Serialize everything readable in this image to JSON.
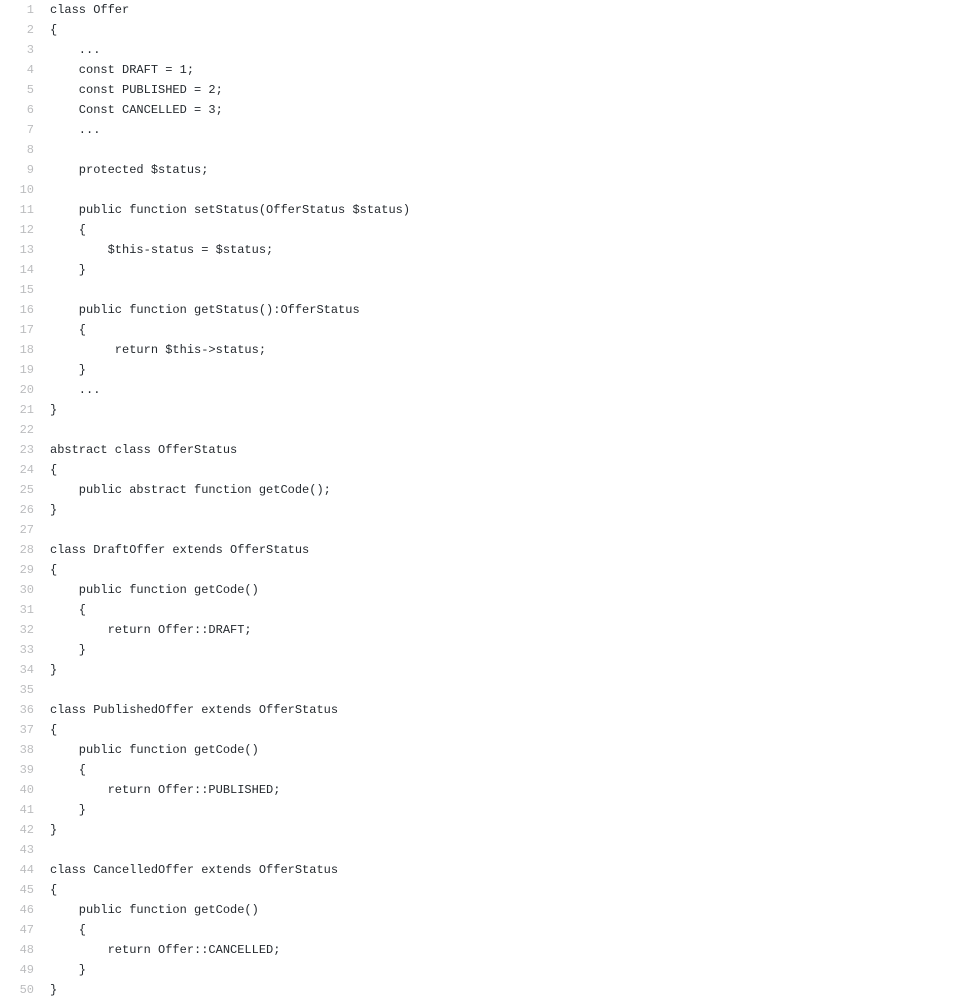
{
  "code": {
    "lines": [
      {
        "num": "1",
        "text": "class Offer"
      },
      {
        "num": "2",
        "text": "{"
      },
      {
        "num": "3",
        "text": "    ..."
      },
      {
        "num": "4",
        "text": "    const DRAFT = 1;"
      },
      {
        "num": "5",
        "text": "    const PUBLISHED = 2;"
      },
      {
        "num": "6",
        "text": "    Const CANCELLED = 3;"
      },
      {
        "num": "7",
        "text": "    ..."
      },
      {
        "num": "8",
        "text": ""
      },
      {
        "num": "9",
        "text": "    protected $status;"
      },
      {
        "num": "10",
        "text": ""
      },
      {
        "num": "11",
        "text": "    public function setStatus(OfferStatus $status)"
      },
      {
        "num": "12",
        "text": "    {"
      },
      {
        "num": "13",
        "text": "        $this-status = $status;"
      },
      {
        "num": "14",
        "text": "    }"
      },
      {
        "num": "15",
        "text": ""
      },
      {
        "num": "16",
        "text": "    public function getStatus():OfferStatus"
      },
      {
        "num": "17",
        "text": "    {"
      },
      {
        "num": "18",
        "text": "         return $this->status;"
      },
      {
        "num": "19",
        "text": "    }"
      },
      {
        "num": "20",
        "text": "    ..."
      },
      {
        "num": "21",
        "text": "}"
      },
      {
        "num": "22",
        "text": ""
      },
      {
        "num": "23",
        "text": "abstract class OfferStatus"
      },
      {
        "num": "24",
        "text": "{"
      },
      {
        "num": "25",
        "text": "    public abstract function getCode();"
      },
      {
        "num": "26",
        "text": "}"
      },
      {
        "num": "27",
        "text": ""
      },
      {
        "num": "28",
        "text": "class DraftOffer extends OfferStatus"
      },
      {
        "num": "29",
        "text": "{"
      },
      {
        "num": "30",
        "text": "    public function getCode()"
      },
      {
        "num": "31",
        "text": "    {"
      },
      {
        "num": "32",
        "text": "        return Offer::DRAFT;"
      },
      {
        "num": "33",
        "text": "    }"
      },
      {
        "num": "34",
        "text": "}"
      },
      {
        "num": "35",
        "text": ""
      },
      {
        "num": "36",
        "text": "class PublishedOffer extends OfferStatus"
      },
      {
        "num": "37",
        "text": "{"
      },
      {
        "num": "38",
        "text": "    public function getCode()"
      },
      {
        "num": "39",
        "text": "    {"
      },
      {
        "num": "40",
        "text": "        return Offer::PUBLISHED;"
      },
      {
        "num": "41",
        "text": "    }"
      },
      {
        "num": "42",
        "text": "}"
      },
      {
        "num": "43",
        "text": ""
      },
      {
        "num": "44",
        "text": "class CancelledOffer extends OfferStatus"
      },
      {
        "num": "45",
        "text": "{"
      },
      {
        "num": "46",
        "text": "    public function getCode()"
      },
      {
        "num": "47",
        "text": "    {"
      },
      {
        "num": "48",
        "text": "        return Offer::CANCELLED;"
      },
      {
        "num": "49",
        "text": "    }"
      },
      {
        "num": "50",
        "text": "}"
      }
    ]
  }
}
